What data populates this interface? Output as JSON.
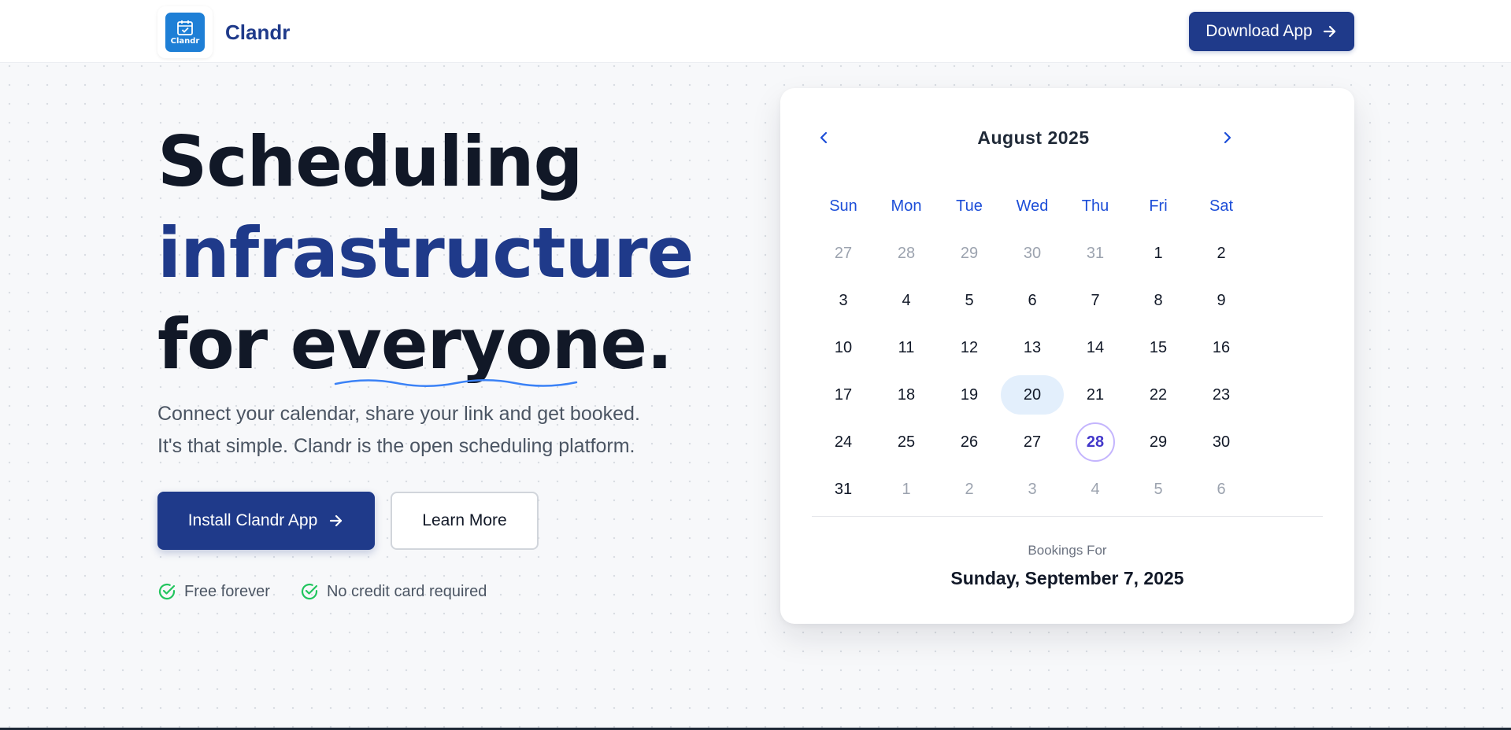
{
  "header": {
    "brand_name": "Clandr",
    "logo_text": "Clandr",
    "download_label": "Download App"
  },
  "hero": {
    "title_line1": "Scheduling",
    "title_line2": "infrastructure",
    "title_line3_prefix": "for ",
    "title_line3_word": "everyone",
    "title_line3_suffix": ".",
    "subtitle_line1": "Connect your calendar, share your link and get booked.",
    "subtitle_line2": "It's that simple. Clandr is the open scheduling platform.",
    "install_label": "Install Clandr App",
    "learn_label": "Learn More",
    "check1": "Free forever",
    "check2": "No credit card required"
  },
  "calendar": {
    "month_label": "August 2025",
    "days_of_week": [
      "Sun",
      "Mon",
      "Tue",
      "Wed",
      "Thu",
      "Fri",
      "Sat"
    ],
    "weeks": [
      [
        {
          "d": "27",
          "muted": true
        },
        {
          "d": "28",
          "muted": true
        },
        {
          "d": "29",
          "muted": true
        },
        {
          "d": "30",
          "muted": true
        },
        {
          "d": "31",
          "muted": true
        },
        {
          "d": "1"
        },
        {
          "d": "2"
        }
      ],
      [
        {
          "d": "3"
        },
        {
          "d": "4"
        },
        {
          "d": "5"
        },
        {
          "d": "6"
        },
        {
          "d": "7"
        },
        {
          "d": "8"
        },
        {
          "d": "9"
        }
      ],
      [
        {
          "d": "10"
        },
        {
          "d": "11"
        },
        {
          "d": "12"
        },
        {
          "d": "13"
        },
        {
          "d": "14"
        },
        {
          "d": "15"
        },
        {
          "d": "16"
        }
      ],
      [
        {
          "d": "17"
        },
        {
          "d": "18"
        },
        {
          "d": "19"
        },
        {
          "d": "20",
          "selected": true
        },
        {
          "d": "21"
        },
        {
          "d": "22"
        },
        {
          "d": "23"
        }
      ],
      [
        {
          "d": "24"
        },
        {
          "d": "25"
        },
        {
          "d": "26"
        },
        {
          "d": "27"
        },
        {
          "d": "28",
          "today": true
        },
        {
          "d": "29"
        },
        {
          "d": "30"
        }
      ],
      [
        {
          "d": "31"
        },
        {
          "d": "1",
          "muted": true
        },
        {
          "d": "2",
          "muted": true
        },
        {
          "d": "3",
          "muted": true
        },
        {
          "d": "4",
          "muted": true
        },
        {
          "d": "5",
          "muted": true
        },
        {
          "d": "6",
          "muted": true
        }
      ]
    ],
    "bookings_label": "Bookings For",
    "bookings_date": "Sunday, September 7, 2025"
  },
  "icons": {
    "download": "arrow-right-icon",
    "install": "arrow-right-icon",
    "checks": "check-circle-icon",
    "prev": "chevron-left-icon",
    "next": "chevron-right-icon",
    "logo": "calendar-check-icon"
  },
  "colors": {
    "primary": "#1f3a8a",
    "accent_blue": "#1d4ed8",
    "check_green": "#22c55e",
    "logo_blue": "#1e7fd6",
    "selected_bg": "#e3effc",
    "today_ring": "#c4b5fd"
  }
}
